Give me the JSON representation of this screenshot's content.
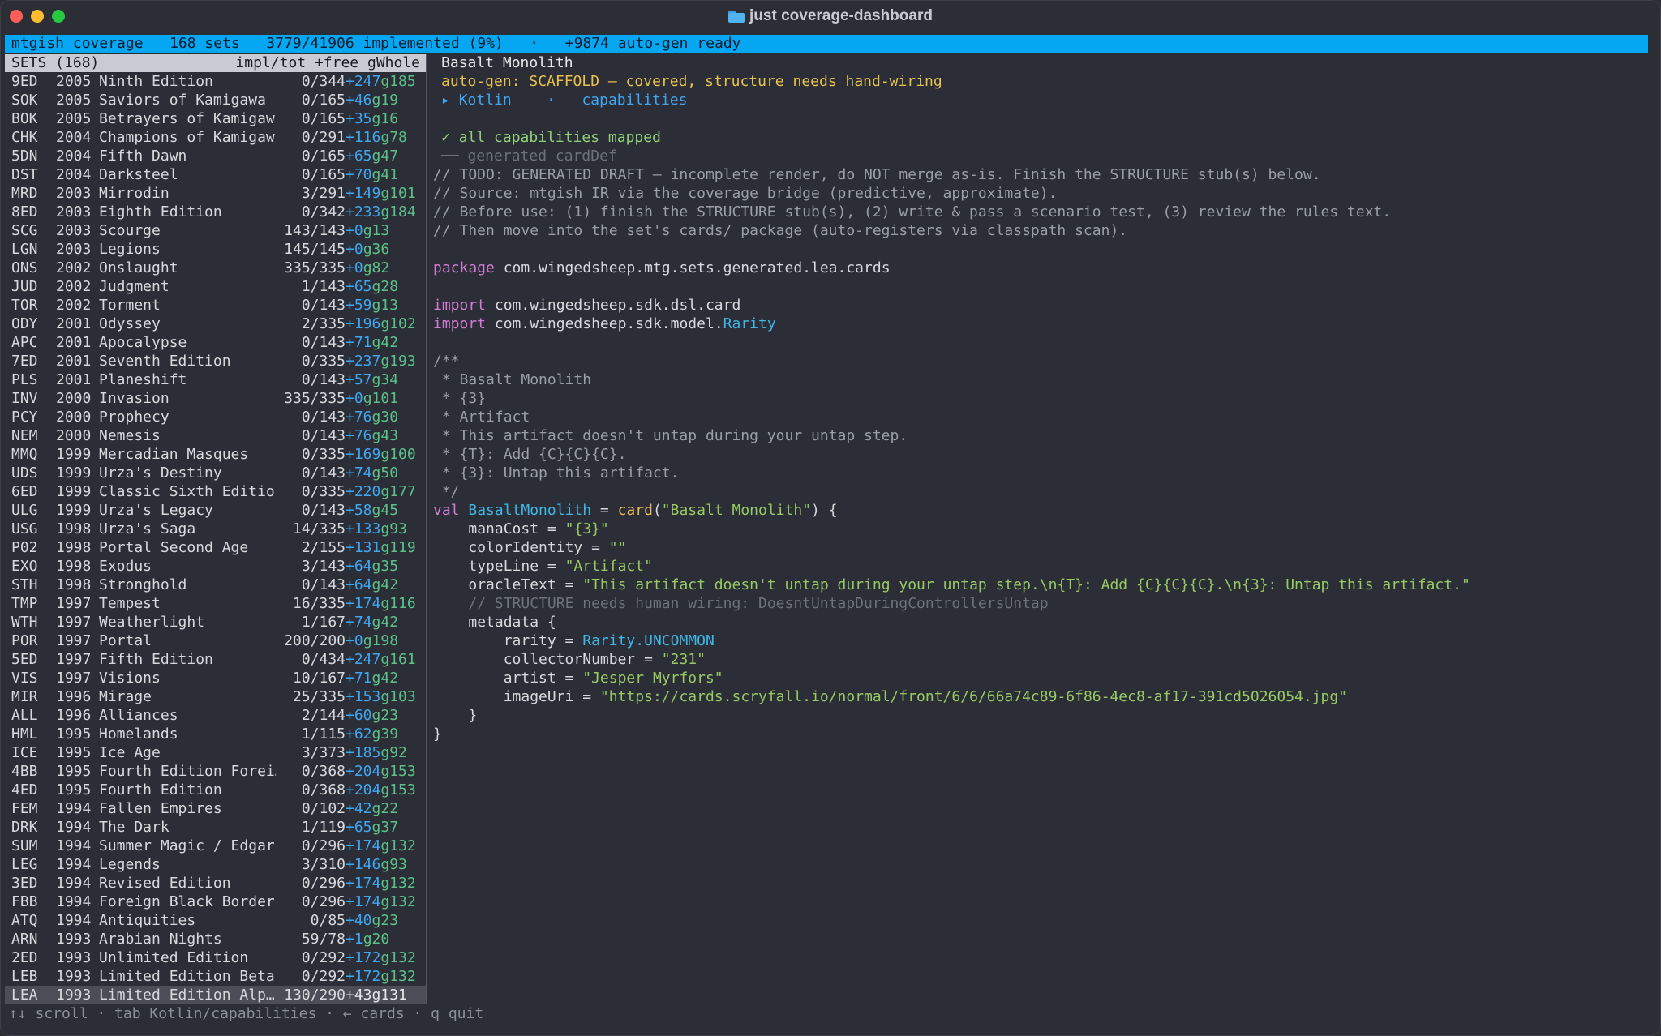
{
  "window": {
    "title": "just coverage-dashboard"
  },
  "status": {
    "app": "mtgish coverage",
    "sets": "168 sets",
    "implemented": "3779/41906 implemented (9%)",
    "sep": "·",
    "autogen": "+9874 auto-gen ready"
  },
  "sets_panel": {
    "title": "SETS (168)",
    "columns": "impl/tot +free gWhole",
    "rows": [
      {
        "code": "9ED",
        "year": "2005",
        "name": "Ninth Edition",
        "impl": "0/344",
        "free": "+247",
        "g": "g185"
      },
      {
        "code": "SOK",
        "year": "2005",
        "name": "Saviors of Kamigawa",
        "impl": "0/165",
        "free": "+46",
        "g": "g19"
      },
      {
        "code": "BOK",
        "year": "2005",
        "name": "Betrayers of Kamigawa",
        "impl": "0/165",
        "free": "+35",
        "g": "g16"
      },
      {
        "code": "CHK",
        "year": "2004",
        "name": "Champions of Kamigawa",
        "impl": "0/291",
        "free": "+116",
        "g": "g78"
      },
      {
        "code": "5DN",
        "year": "2004",
        "name": "Fifth Dawn",
        "impl": "0/165",
        "free": "+65",
        "g": "g47"
      },
      {
        "code": "DST",
        "year": "2004",
        "name": "Darksteel",
        "impl": "0/165",
        "free": "+70",
        "g": "g41"
      },
      {
        "code": "MRD",
        "year": "2003",
        "name": "Mirrodin",
        "impl": "3/291",
        "free": "+149",
        "g": "g101"
      },
      {
        "code": "8ED",
        "year": "2003",
        "name": "Eighth Edition",
        "impl": "0/342",
        "free": "+233",
        "g": "g184"
      },
      {
        "code": "SCG",
        "year": "2003",
        "name": "Scourge",
        "impl": "143/143",
        "free": "+0",
        "g": "g13"
      },
      {
        "code": "LGN",
        "year": "2003",
        "name": "Legions",
        "impl": "145/145",
        "free": "+0",
        "g": "g36"
      },
      {
        "code": "ONS",
        "year": "2002",
        "name": "Onslaught",
        "impl": "335/335",
        "free": "+0",
        "g": "g82"
      },
      {
        "code": "JUD",
        "year": "2002",
        "name": "Judgment",
        "impl": "1/143",
        "free": "+65",
        "g": "g28"
      },
      {
        "code": "TOR",
        "year": "2002",
        "name": "Torment",
        "impl": "0/143",
        "free": "+59",
        "g": "g13"
      },
      {
        "code": "ODY",
        "year": "2001",
        "name": "Odyssey",
        "impl": "2/335",
        "free": "+196",
        "g": "g102"
      },
      {
        "code": "APC",
        "year": "2001",
        "name": "Apocalypse",
        "impl": "0/143",
        "free": "+71",
        "g": "g42"
      },
      {
        "code": "7ED",
        "year": "2001",
        "name": "Seventh Edition",
        "impl": "0/335",
        "free": "+237",
        "g": "g193"
      },
      {
        "code": "PLS",
        "year": "2001",
        "name": "Planeshift",
        "impl": "0/143",
        "free": "+57",
        "g": "g34"
      },
      {
        "code": "INV",
        "year": "2000",
        "name": "Invasion",
        "impl": "335/335",
        "free": "+0",
        "g": "g101"
      },
      {
        "code": "PCY",
        "year": "2000",
        "name": "Prophecy",
        "impl": "0/143",
        "free": "+76",
        "g": "g30"
      },
      {
        "code": "NEM",
        "year": "2000",
        "name": "Nemesis",
        "impl": "0/143",
        "free": "+76",
        "g": "g43"
      },
      {
        "code": "MMQ",
        "year": "1999",
        "name": "Mercadian Masques",
        "impl": "0/335",
        "free": "+169",
        "g": "g100"
      },
      {
        "code": "UDS",
        "year": "1999",
        "name": "Urza's Destiny",
        "impl": "0/143",
        "free": "+74",
        "g": "g50"
      },
      {
        "code": "6ED",
        "year": "1999",
        "name": "Classic Sixth Edition",
        "impl": "0/335",
        "free": "+220",
        "g": "g177"
      },
      {
        "code": "ULG",
        "year": "1999",
        "name": "Urza's Legacy",
        "impl": "0/143",
        "free": "+58",
        "g": "g45"
      },
      {
        "code": "USG",
        "year": "1998",
        "name": "Urza's Saga",
        "impl": "14/335",
        "free": "+133",
        "g": "g93"
      },
      {
        "code": "P02",
        "year": "1998",
        "name": "Portal Second Age",
        "impl": "2/155",
        "free": "+131",
        "g": "g119"
      },
      {
        "code": "EXO",
        "year": "1998",
        "name": "Exodus",
        "impl": "3/143",
        "free": "+64",
        "g": "g35"
      },
      {
        "code": "STH",
        "year": "1998",
        "name": "Stronghold",
        "impl": "0/143",
        "free": "+64",
        "g": "g42"
      },
      {
        "code": "TMP",
        "year": "1997",
        "name": "Tempest",
        "impl": "16/335",
        "free": "+174",
        "g": "g116"
      },
      {
        "code": "WTH",
        "year": "1997",
        "name": "Weatherlight",
        "impl": "1/167",
        "free": "+74",
        "g": "g42"
      },
      {
        "code": "POR",
        "year": "1997",
        "name": "Portal",
        "impl": "200/200",
        "free": "+0",
        "g": "g198"
      },
      {
        "code": "5ED",
        "year": "1997",
        "name": "Fifth Edition",
        "impl": "0/434",
        "free": "+247",
        "g": "g161"
      },
      {
        "code": "VIS",
        "year": "1997",
        "name": "Visions",
        "impl": "10/167",
        "free": "+71",
        "g": "g42"
      },
      {
        "code": "MIR",
        "year": "1996",
        "name": "Mirage",
        "impl": "25/335",
        "free": "+153",
        "g": "g103"
      },
      {
        "code": "ALL",
        "year": "1996",
        "name": "Alliances",
        "impl": "2/144",
        "free": "+60",
        "g": "g23"
      },
      {
        "code": "HML",
        "year": "1995",
        "name": "Homelands",
        "impl": "1/115",
        "free": "+62",
        "g": "g39"
      },
      {
        "code": "ICE",
        "year": "1995",
        "name": "Ice Age",
        "impl": "3/373",
        "free": "+185",
        "g": "g92"
      },
      {
        "code": "4BB",
        "year": "1995",
        "name": "Fourth Edition Forei…",
        "impl": "0/368",
        "free": "+204",
        "g": "g153"
      },
      {
        "code": "4ED",
        "year": "1995",
        "name": "Fourth Edition",
        "impl": "0/368",
        "free": "+204",
        "g": "g153"
      },
      {
        "code": "FEM",
        "year": "1994",
        "name": "Fallen Empires",
        "impl": "0/102",
        "free": "+42",
        "g": "g22"
      },
      {
        "code": "DRK",
        "year": "1994",
        "name": "The Dark",
        "impl": "1/119",
        "free": "+65",
        "g": "g37"
      },
      {
        "code": "SUM",
        "year": "1994",
        "name": "Summer Magic / Edgar",
        "impl": "0/296",
        "free": "+174",
        "g": "g132"
      },
      {
        "code": "LEG",
        "year": "1994",
        "name": "Legends",
        "impl": "3/310",
        "free": "+146",
        "g": "g93"
      },
      {
        "code": "3ED",
        "year": "1994",
        "name": "Revised Edition",
        "impl": "0/296",
        "free": "+174",
        "g": "g132"
      },
      {
        "code": "FBB",
        "year": "1994",
        "name": "Foreign Black Border",
        "impl": "0/296",
        "free": "+174",
        "g": "g132"
      },
      {
        "code": "ATQ",
        "year": "1994",
        "name": "Antiquities",
        "impl": "0/85",
        "free": "+40",
        "g": "g23"
      },
      {
        "code": "ARN",
        "year": "1993",
        "name": "Arabian Nights",
        "impl": "59/78",
        "free": "+1",
        "g": "g20"
      },
      {
        "code": "2ED",
        "year": "1993",
        "name": "Unlimited Edition",
        "impl": "0/292",
        "free": "+172",
        "g": "g132"
      },
      {
        "code": "LEB",
        "year": "1993",
        "name": "Limited Edition Beta",
        "impl": "0/292",
        "free": "+172",
        "g": "g132"
      },
      {
        "code": "LEA",
        "year": "1993",
        "name": "Limited Edition Alp…",
        "impl": "130/290",
        "free": "+43",
        "g": "g131"
      }
    ]
  },
  "detail": {
    "card_name": "Basalt Monolith",
    "autogen": "auto-gen: SCAFFOLD — covered, structure needs hand-wiring",
    "tab_marker": "▸",
    "tab_kotlin": "Kotlin",
    "tab_sep": "·",
    "tab_caps": "capabilities",
    "caps_ok": "✓ all capabilities mapped",
    "gen_label": "── generated cardDef",
    "comments": [
      "// TODO: GENERATED DRAFT — incomplete render, do NOT merge as-is. Finish the STRUCTURE stub(s) below.",
      "// Source: mtgish IR via the coverage bridge (predictive, approximate).",
      "// Before use: (1) finish the STRUCTURE stub(s), (2) write & pass a scenario test, (3) review the rules text.",
      "// Then move into the set's cards/ package (auto-registers via classpath scan)."
    ],
    "kw_package": "package",
    "package_name": "com.wingedsheep.mtg.sets.generated.lea.cards",
    "kw_import": "import",
    "import1": "com.wingedsheep.sdk.dsl.card",
    "import2_pre": "com.wingedsheep.sdk.model.",
    "import2_cls": "Rarity",
    "doc": [
      "/**",
      " * Basalt Monolith",
      " * {3}",
      " * Artifact",
      " * This artifact doesn't untap during your untap step.",
      " * {T}: Add {C}{C}{C}.",
      " * {3}: Untap this artifact.",
      " */"
    ],
    "kw_val": "val",
    "val_name": "BasaltMonolith",
    "eq": " = ",
    "fn_card": "card",
    "card_arg": "\"Basalt Monolith\"",
    "open": ") {",
    "manaCost_k": "manaCost = ",
    "manaCost_v": "\"{3}\"",
    "colorIdentity_k": "colorIdentity = ",
    "colorIdentity_v": "\"\"",
    "typeLine_k": "typeLine = ",
    "typeLine_v": "\"Artifact\"",
    "oracleText_k": "oracleText = ",
    "oracleText_v": "\"This artifact doesn't untap during your untap step.\\n{T}: Add {C}{C}{C}.\\n{3}: Untap this artifact.\"",
    "structure_comment": "// STRUCTURE needs human wiring: DoesntUntapDuringControllersUntap",
    "metadata_open": "metadata {",
    "rarity_k": "rarity = ",
    "rarity_v": "Rarity.UNCOMMON",
    "collector_k": "collectorNumber = ",
    "collector_v": "\"231\"",
    "artist_k": "artist = ",
    "artist_v": "\"Jesper Myrfors\"",
    "image_k": "imageUri = ",
    "image_v": "\"https://cards.scryfall.io/normal/front/6/6/66a74c89-6f86-4ec8-af17-391cd5026054.jpg\"",
    "close_inner": "}",
    "close_outer": "}"
  },
  "footer": "↑↓ scroll · tab Kotlin/capabilities · ← cards · q quit",
  "colors": {
    "status_bg": "#05a7f3",
    "keyword": "#d47bd6",
    "string": "#98c963",
    "free": "#3fa6f2",
    "gwhole": "#5cc088",
    "warning": "#e9c04d"
  }
}
